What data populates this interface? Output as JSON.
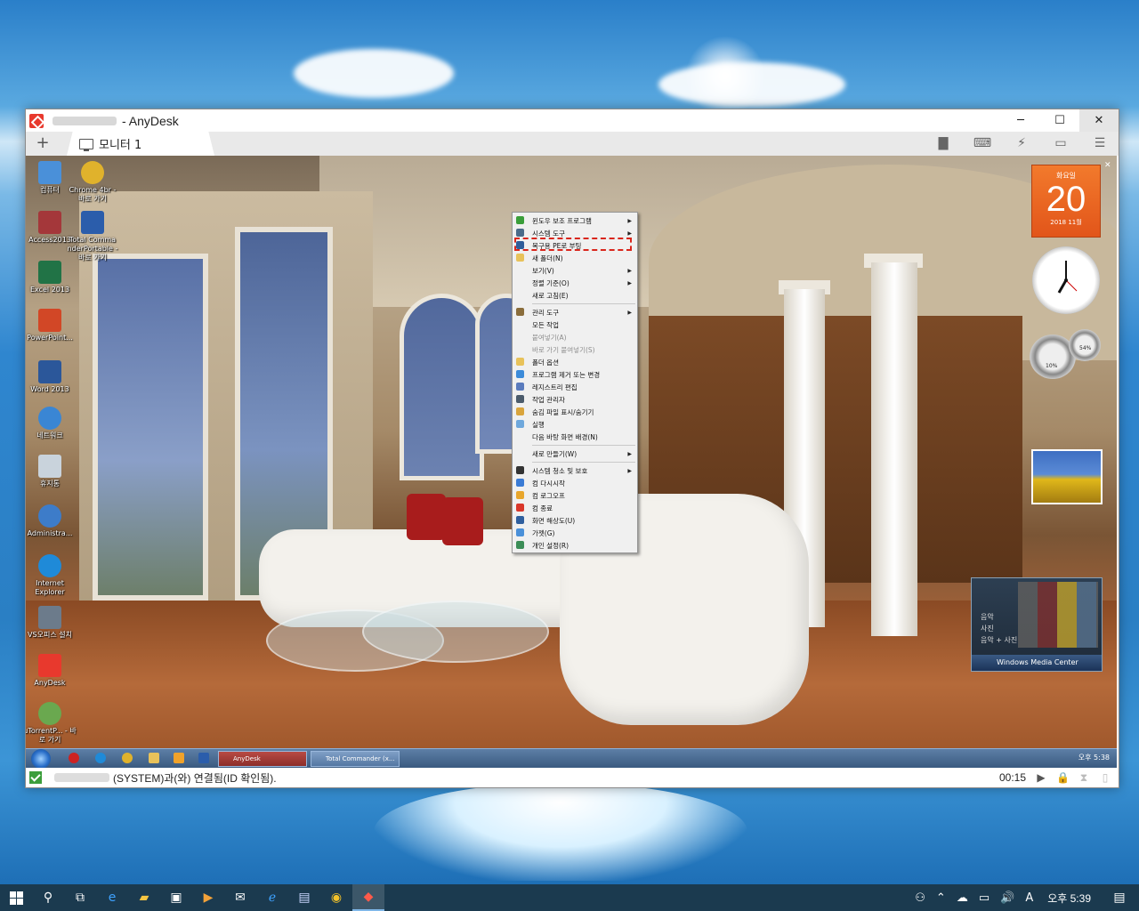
{
  "window": {
    "title": "- AnyDesk",
    "controls": {
      "minimize": "─",
      "maximize": "☐",
      "close": "✕"
    }
  },
  "tabbar": {
    "add_label": "+",
    "tabs": [
      {
        "label": "모니터 1"
      }
    ],
    "toolbar_icons": [
      "chat-icon",
      "keyboard-icon",
      "actions-icon",
      "display-icon",
      "menu-icon"
    ]
  },
  "remote": {
    "desktop_icons": [
      {
        "label": "컴퓨터",
        "color": "#4a90d9"
      },
      {
        "label": "Chrome 4br - 바로 가기",
        "color": "#e0b22c"
      },
      {
        "label": "Access2013",
        "color": "#a4373a"
      },
      {
        "label": "Total Comma nderPortable - 바로 가기",
        "color": "#2b5dab"
      },
      {
        "label": "Excel 2013",
        "color": "#217346"
      },
      {
        "label": "PowerPoint...",
        "color": "#d24726"
      },
      {
        "label": "Word 2013",
        "color": "#2b579a"
      },
      {
        "label": "네트워크",
        "color": "#3a86d4"
      },
      {
        "label": "휴지통",
        "color": "#c9d3dc"
      },
      {
        "label": "Administra...",
        "color": "#3d7cc9"
      },
      {
        "label": "Internet Explorer",
        "color": "#1f8ad8"
      },
      {
        "label": "VS오피스 설치",
        "color": "#6c7b8b"
      },
      {
        "label": "AnyDesk",
        "color": "#e8392d"
      },
      {
        "label": "uTorrentP... - 바로 가기",
        "color": "#6aa84f"
      }
    ],
    "context_menu": [
      {
        "label": "윈도우 보조 프로그램",
        "submenu": true,
        "icon_color": "#3a9e3a"
      },
      {
        "label": "시스템 도구",
        "submenu": true,
        "icon_color": "#4a6b8a"
      },
      {
        "label": "복구용 PE로 부팅",
        "submenu": false,
        "icon_color": "#2e5d9a",
        "highlighted": true
      },
      {
        "label": "새 폴더(N)",
        "submenu": false,
        "icon_color": "#e8c25a"
      },
      {
        "label": "보기(V)",
        "submenu": true,
        "icon_color": ""
      },
      {
        "label": "정렬 기준(O)",
        "submenu": true,
        "icon_color": ""
      },
      {
        "label": "새로 고침(E)",
        "submenu": false,
        "icon_color": ""
      },
      {
        "sep": true
      },
      {
        "label": "관리 도구",
        "submenu": true,
        "icon_color": "#8a6d3b"
      },
      {
        "label": "모든 작업",
        "submenu": false,
        "icon_color": ""
      },
      {
        "label": "붙여넣기(A)",
        "submenu": false,
        "icon_color": "",
        "disabled": true
      },
      {
        "label": "바로 가기 붙여넣기(S)",
        "submenu": false,
        "icon_color": "",
        "disabled": true
      },
      {
        "label": "폴더 옵션",
        "submenu": false,
        "icon_color": "#e8c25a"
      },
      {
        "label": "프로그램 제거 또는 변경",
        "submenu": false,
        "icon_color": "#3c8bd9"
      },
      {
        "label": "레지스트리 편집",
        "submenu": false,
        "icon_color": "#5a7bbd"
      },
      {
        "label": "작업 관리자",
        "submenu": false,
        "icon_color": "#4b5b6b"
      },
      {
        "label": "숨김 파일 표시/숨기기",
        "submenu": false,
        "icon_color": "#d9a43c"
      },
      {
        "label": "실행",
        "submenu": false,
        "icon_color": "#6fa8dc"
      },
      {
        "label": "다음 바탕 화면 배경(N)",
        "submenu": false,
        "icon_color": ""
      },
      {
        "sep": true
      },
      {
        "label": "새로 만들기(W)",
        "submenu": true,
        "icon_color": ""
      },
      {
        "sep": true
      },
      {
        "label": "시스템 청소 및 보호",
        "submenu": true,
        "icon_color": "#333333"
      },
      {
        "label": "컴 다시시작",
        "submenu": false,
        "icon_color": "#3a7bd5"
      },
      {
        "label": "컴 로그오프",
        "submenu": false,
        "icon_color": "#e8a62c"
      },
      {
        "label": "컴 종료",
        "submenu": false,
        "icon_color": "#d9372a"
      },
      {
        "label": "화면 해상도(U)",
        "submenu": false,
        "icon_color": "#2f5f9e"
      },
      {
        "label": "가젯(G)",
        "submenu": false,
        "icon_color": "#4a90d9"
      },
      {
        "label": "개인 설정(R)",
        "submenu": false,
        "icon_color": "#3b8d57"
      }
    ],
    "calendar": {
      "day_of_week": "화요일",
      "day": "20",
      "month": "2018 11월"
    },
    "meter": {
      "cpu": "10%",
      "memory": "54%"
    },
    "wmc": {
      "items": [
        "음악",
        "사진",
        "음악 + 사진"
      ],
      "bar_label": "Windows Media Center"
    },
    "taskbar": {
      "tasks": [
        "AnyDesk",
        "Total Commander (x..."
      ],
      "tray_time": "오후 5:38"
    }
  },
  "statusbar": {
    "message": "(SYSTEM)과(와) 연결됨(ID 확인됨).",
    "timer": "00:15"
  },
  "host_taskbar": {
    "apps": [
      "search-icon",
      "task-view-icon",
      "edge-icon",
      "explorer-icon",
      "store-icon",
      "media-icon",
      "mail-icon",
      "ie-icon",
      "totalcmd-icon",
      "chrome-icon",
      "anydesk-icon"
    ],
    "tray_ime": "A",
    "time": "오후 5:39"
  }
}
